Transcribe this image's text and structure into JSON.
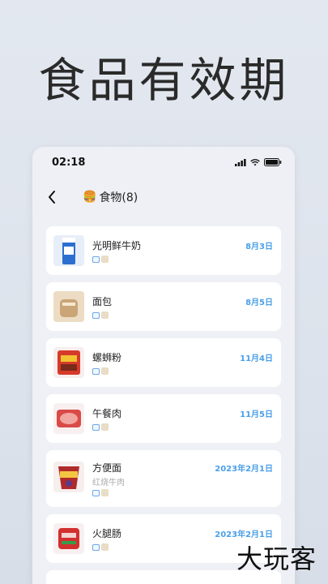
{
  "headline": "食品有效期",
  "status_bar": {
    "time": "02:18"
  },
  "nav": {
    "title": "食物(8)",
    "title_icon": "🍔"
  },
  "items": [
    {
      "name": "光明鲜牛奶",
      "sub": "",
      "date": "8月3日",
      "thumb_color": "#2b6fd1"
    },
    {
      "name": "面包",
      "sub": "",
      "date": "8月5日",
      "thumb_color": "#c9a577"
    },
    {
      "name": "螺蛳粉",
      "sub": "",
      "date": "11月4日",
      "thumb_color": "#d63a2a"
    },
    {
      "name": "午餐肉",
      "sub": "",
      "date": "11月5日",
      "thumb_color": "#d94b47"
    },
    {
      "name": "方便面",
      "sub": "红烧牛肉",
      "date": "2023年2月1日",
      "thumb_color": "#b02a2a"
    },
    {
      "name": "火腿肠",
      "sub": "",
      "date": "2023年2月1日",
      "thumb_color": "#d2302f"
    }
  ],
  "watermark": "大玩客",
  "colors": {
    "accent": "#4a9fe8",
    "card_bg": "#ffffff",
    "panel_bg": "#eef0f5"
  }
}
